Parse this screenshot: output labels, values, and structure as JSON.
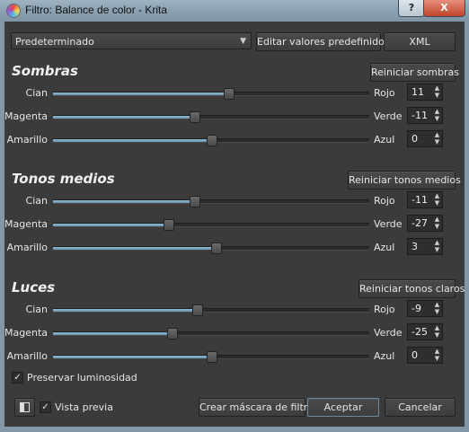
{
  "window": {
    "title": "Filtro: Balance de color - Krita",
    "help_label": "?",
    "close_label": "X"
  },
  "top": {
    "preset": "Predeterminado",
    "edit_presets": "Editar valores predefinidos",
    "xml": "XML"
  },
  "sections": [
    {
      "title": "Sombras",
      "reset": "Reiniciar sombras",
      "rows": [
        {
          "left": "Cian",
          "right": "Rojo",
          "value": "11",
          "level": 0.11
        },
        {
          "left": "Magenta",
          "right": "Verde",
          "value": "-11",
          "level": -0.11
        },
        {
          "left": "Amarillo",
          "right": "Azul",
          "value": "0",
          "level": 0
        }
      ]
    },
    {
      "title": "Tonos medios",
      "reset": "Reiniciar tonos medios",
      "rows": [
        {
          "left": "Cian",
          "right": "Rojo",
          "value": "-11",
          "level": -0.11
        },
        {
          "left": "Magenta",
          "right": "Verde",
          "value": "-27",
          "level": -0.27
        },
        {
          "left": "Amarillo",
          "right": "Azul",
          "value": "3",
          "level": 0.03
        }
      ]
    },
    {
      "title": "Luces",
      "reset": "Reiniciar tonos claros",
      "rows": [
        {
          "left": "Cian",
          "right": "Rojo",
          "value": "-9",
          "level": -0.09
        },
        {
          "left": "Magenta",
          "right": "Verde",
          "value": "-25",
          "level": -0.25
        },
        {
          "left": "Amarillo",
          "right": "Azul",
          "value": "0",
          "level": 0
        }
      ]
    }
  ],
  "preserve_luminosity": {
    "label": "Preservar luminosidad",
    "checked": true
  },
  "bottom": {
    "preview_label": "Vista previa",
    "preview_checked": true,
    "create_mask": "Crear máscara de filtro",
    "accept": "Aceptar",
    "cancel": "Cancelar"
  },
  "colors": {
    "slider_fill": "#7aa6c4",
    "title_bar": "#8da2b2",
    "dialog_bg": "#3b3b3b"
  }
}
